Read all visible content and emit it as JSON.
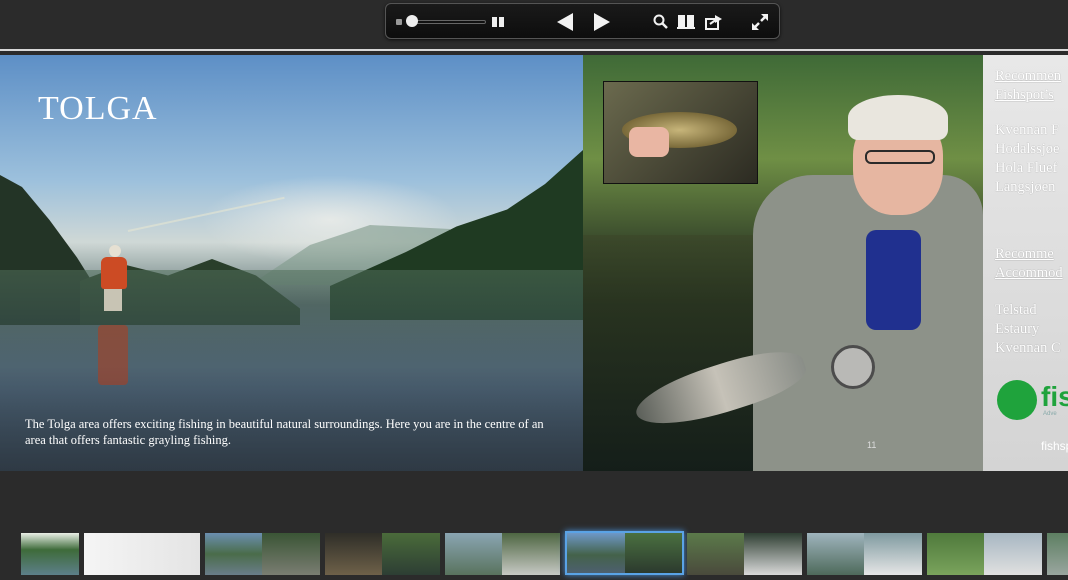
{
  "toolbar": {
    "icons": [
      "slider-min-icon",
      "page-grid-icon",
      "prev-page-icon",
      "next-page-icon",
      "search-icon",
      "book-icon",
      "share-icon",
      "fullscreen-icon"
    ]
  },
  "left_page": {
    "title": "TOLGA",
    "caption": "The Tolga area offers exciting fishing in beautiful natural surroundings. Here you are in the centre of an area that offers fantastic grayling fishing."
  },
  "right_page": {
    "page_number": "11"
  },
  "side_page": {
    "heading1_line1": "Recommen",
    "heading1_line2": "Fishspot’s",
    "list1": [
      "Kvennan F",
      "Hodalssjøe",
      "Hola Fluef",
      "Langsjøen"
    ],
    "heading2_line1": "Recomme",
    "heading2_line2": "Accommod",
    "list2": [
      "Telstad",
      "Estaury",
      "Kvennan C"
    ],
    "logo_text": "fis",
    "logo_sub": "Adve",
    "site": "fishsp"
  },
  "colors": {
    "background": "#2b2b2b",
    "selected_thumb_border": "#5aa3e6",
    "logo_green": "#1fa33c"
  }
}
